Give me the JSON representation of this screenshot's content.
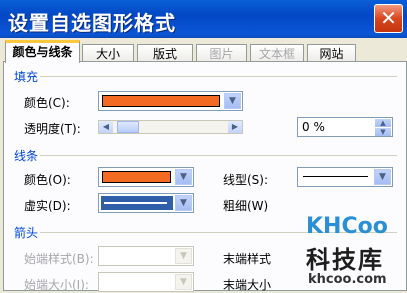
{
  "window": {
    "title": "设置自选图形格式",
    "close_symbol": "✕"
  },
  "tabs": [
    {
      "label": "颜色与线条",
      "state": "active"
    },
    {
      "label": "大小",
      "state": "normal"
    },
    {
      "label": "版式",
      "state": "normal"
    },
    {
      "label": "图片",
      "state": "disabled"
    },
    {
      "label": "文本框",
      "state": "disabled"
    },
    {
      "label": "网站",
      "state": "normal"
    }
  ],
  "fill": {
    "section_title": "填充",
    "color_label": "颜色(C):",
    "color_value": "#f36b22",
    "transparency_label": "透明度(T):",
    "transparency_value": "0 %"
  },
  "line": {
    "section_title": "线条",
    "color_label": "颜色(O):",
    "color_value": "#f36b22",
    "style_label": "线型(S):",
    "dash_label": "虚实(D):",
    "weight_label": "粗细(W)"
  },
  "arrows": {
    "section_title": "箭头",
    "begin_style_label": "始端样式(B):",
    "end_style_label": "末端样式",
    "begin_size_label": "始端大小(I):",
    "end_size_label": "末端大小"
  },
  "watermark": {
    "brand": "KHCoo",
    "text_cn": "科技库",
    "url": "khcoo.com"
  },
  "colors": {
    "accent": "#0046d5",
    "title_bar": "#0a5fd8",
    "fill_orange": "#f36b22"
  }
}
